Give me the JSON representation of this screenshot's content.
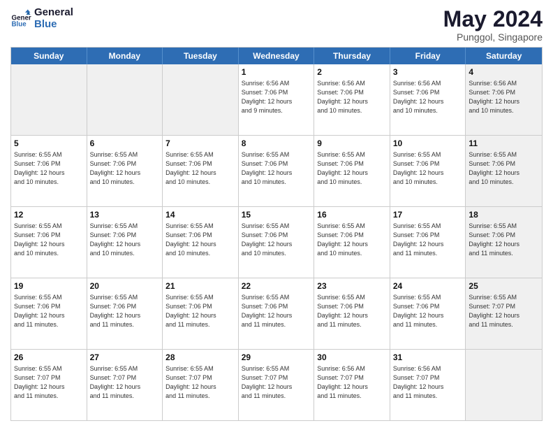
{
  "logo": {
    "name": "General",
    "name2": "Blue"
  },
  "header": {
    "title": "May 2024",
    "subtitle": "Punggol, Singapore"
  },
  "weekdays": [
    "Sunday",
    "Monday",
    "Tuesday",
    "Wednesday",
    "Thursday",
    "Friday",
    "Saturday"
  ],
  "weeks": [
    [
      {
        "day": "",
        "info": "",
        "shaded": true
      },
      {
        "day": "",
        "info": "",
        "shaded": true
      },
      {
        "day": "",
        "info": "",
        "shaded": true
      },
      {
        "day": "1",
        "info": "Sunrise: 6:56 AM\nSunset: 7:06 PM\nDaylight: 12 hours\nand 9 minutes."
      },
      {
        "day": "2",
        "info": "Sunrise: 6:56 AM\nSunset: 7:06 PM\nDaylight: 12 hours\nand 10 minutes."
      },
      {
        "day": "3",
        "info": "Sunrise: 6:56 AM\nSunset: 7:06 PM\nDaylight: 12 hours\nand 10 minutes."
      },
      {
        "day": "4",
        "info": "Sunrise: 6:56 AM\nSunset: 7:06 PM\nDaylight: 12 hours\nand 10 minutes.",
        "shaded": true
      }
    ],
    [
      {
        "day": "5",
        "info": "Sunrise: 6:55 AM\nSunset: 7:06 PM\nDaylight: 12 hours\nand 10 minutes."
      },
      {
        "day": "6",
        "info": "Sunrise: 6:55 AM\nSunset: 7:06 PM\nDaylight: 12 hours\nand 10 minutes."
      },
      {
        "day": "7",
        "info": "Sunrise: 6:55 AM\nSunset: 7:06 PM\nDaylight: 12 hours\nand 10 minutes."
      },
      {
        "day": "8",
        "info": "Sunrise: 6:55 AM\nSunset: 7:06 PM\nDaylight: 12 hours\nand 10 minutes."
      },
      {
        "day": "9",
        "info": "Sunrise: 6:55 AM\nSunset: 7:06 PM\nDaylight: 12 hours\nand 10 minutes."
      },
      {
        "day": "10",
        "info": "Sunrise: 6:55 AM\nSunset: 7:06 PM\nDaylight: 12 hours\nand 10 minutes."
      },
      {
        "day": "11",
        "info": "Sunrise: 6:55 AM\nSunset: 7:06 PM\nDaylight: 12 hours\nand 10 minutes.",
        "shaded": true
      }
    ],
    [
      {
        "day": "12",
        "info": "Sunrise: 6:55 AM\nSunset: 7:06 PM\nDaylight: 12 hours\nand 10 minutes."
      },
      {
        "day": "13",
        "info": "Sunrise: 6:55 AM\nSunset: 7:06 PM\nDaylight: 12 hours\nand 10 minutes."
      },
      {
        "day": "14",
        "info": "Sunrise: 6:55 AM\nSunset: 7:06 PM\nDaylight: 12 hours\nand 10 minutes."
      },
      {
        "day": "15",
        "info": "Sunrise: 6:55 AM\nSunset: 7:06 PM\nDaylight: 12 hours\nand 10 minutes."
      },
      {
        "day": "16",
        "info": "Sunrise: 6:55 AM\nSunset: 7:06 PM\nDaylight: 12 hours\nand 10 minutes."
      },
      {
        "day": "17",
        "info": "Sunrise: 6:55 AM\nSunset: 7:06 PM\nDaylight: 12 hours\nand 11 minutes."
      },
      {
        "day": "18",
        "info": "Sunrise: 6:55 AM\nSunset: 7:06 PM\nDaylight: 12 hours\nand 11 minutes.",
        "shaded": true
      }
    ],
    [
      {
        "day": "19",
        "info": "Sunrise: 6:55 AM\nSunset: 7:06 PM\nDaylight: 12 hours\nand 11 minutes."
      },
      {
        "day": "20",
        "info": "Sunrise: 6:55 AM\nSunset: 7:06 PM\nDaylight: 12 hours\nand 11 minutes."
      },
      {
        "day": "21",
        "info": "Sunrise: 6:55 AM\nSunset: 7:06 PM\nDaylight: 12 hours\nand 11 minutes."
      },
      {
        "day": "22",
        "info": "Sunrise: 6:55 AM\nSunset: 7:06 PM\nDaylight: 12 hours\nand 11 minutes."
      },
      {
        "day": "23",
        "info": "Sunrise: 6:55 AM\nSunset: 7:06 PM\nDaylight: 12 hours\nand 11 minutes."
      },
      {
        "day": "24",
        "info": "Sunrise: 6:55 AM\nSunset: 7:06 PM\nDaylight: 12 hours\nand 11 minutes."
      },
      {
        "day": "25",
        "info": "Sunrise: 6:55 AM\nSunset: 7:07 PM\nDaylight: 12 hours\nand 11 minutes.",
        "shaded": true
      }
    ],
    [
      {
        "day": "26",
        "info": "Sunrise: 6:55 AM\nSunset: 7:07 PM\nDaylight: 12 hours\nand 11 minutes."
      },
      {
        "day": "27",
        "info": "Sunrise: 6:55 AM\nSunset: 7:07 PM\nDaylight: 12 hours\nand 11 minutes."
      },
      {
        "day": "28",
        "info": "Sunrise: 6:55 AM\nSunset: 7:07 PM\nDaylight: 12 hours\nand 11 minutes."
      },
      {
        "day": "29",
        "info": "Sunrise: 6:55 AM\nSunset: 7:07 PM\nDaylight: 12 hours\nand 11 minutes."
      },
      {
        "day": "30",
        "info": "Sunrise: 6:56 AM\nSunset: 7:07 PM\nDaylight: 12 hours\nand 11 minutes."
      },
      {
        "day": "31",
        "info": "Sunrise: 6:56 AM\nSunset: 7:07 PM\nDaylight: 12 hours\nand 11 minutes."
      },
      {
        "day": "",
        "info": "",
        "shaded": true
      }
    ]
  ]
}
